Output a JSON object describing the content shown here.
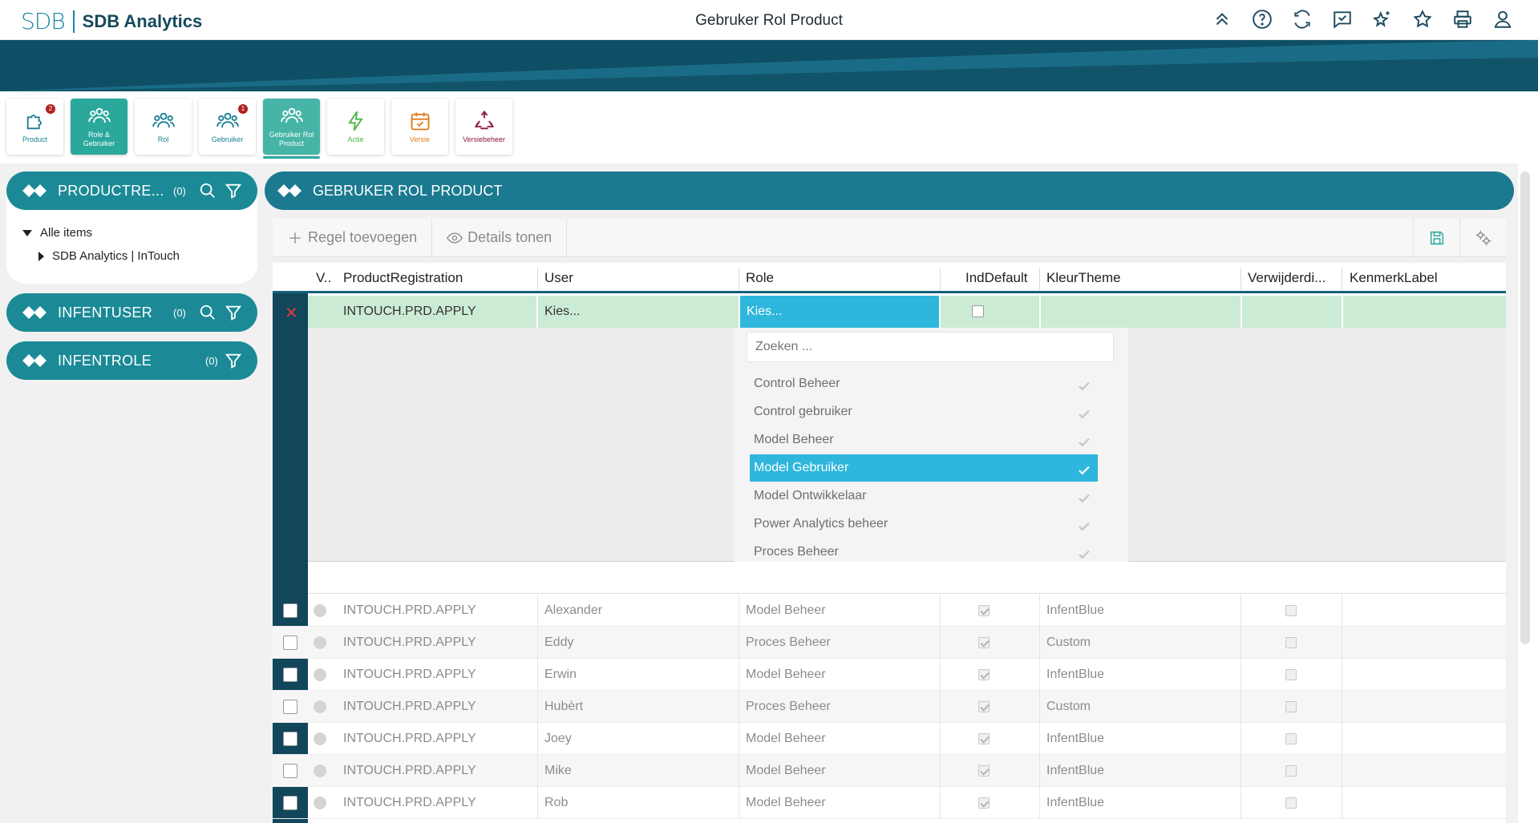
{
  "header": {
    "logo_mark": "SDB",
    "logo_text": "SDB Analytics",
    "title": "Gebruker Rol Product",
    "icons": [
      "chevrons-up-icon",
      "help-icon",
      "refresh-icon",
      "chat-check-icon",
      "sparkle-star-icon",
      "star-icon",
      "print-icon",
      "user-icon"
    ]
  },
  "tiles": [
    {
      "label": "Product",
      "badge": "2",
      "icon": "puzzle-icon"
    },
    {
      "label": "Role & Gebruiker",
      "badge": "",
      "icon": "users-icon"
    },
    {
      "label": "Rol",
      "badge": "",
      "icon": "users-icon"
    },
    {
      "label": "Gebruiker",
      "badge": "1",
      "icon": "users-icon"
    },
    {
      "label": "Gebruiker Rol Product",
      "badge": "",
      "icon": "users-icon"
    },
    {
      "label": "Actie",
      "badge": "",
      "icon": "lightning-icon"
    },
    {
      "label": "Versie",
      "badge": "",
      "icon": "calendar-check-icon"
    },
    {
      "label": "Versiebeheer",
      "badge": "",
      "icon": "recycle-icon"
    }
  ],
  "left": {
    "panels": [
      {
        "title": "PRODUCTRE...",
        "count": "(0)"
      },
      {
        "title": "INFENTUSER",
        "count": "(0)"
      },
      {
        "title": "INFENTROLE",
        "count": "(0)"
      }
    ],
    "tree": {
      "root": "Alle items",
      "child": "SDB Analytics | InTouch"
    }
  },
  "main": {
    "title": "GEBRUKER ROL PRODUCT",
    "add_row": "Regel toevoegen",
    "show_details": "Details tonen",
    "columns": [
      "V..",
      "ProductRegistration",
      "User",
      "Role",
      "IndDefault",
      "KleurTheme",
      "Verwijderdi...",
      "KenmerkLabel"
    ],
    "edit_row": {
      "product": "INTOUCH.PRD.APPLY",
      "user": "Kies...",
      "role": "Kies..."
    },
    "dropdown": {
      "placeholder": "Zoeken ...",
      "items": [
        "Control Beheer",
        "Control gebruiker",
        "Model Beheer",
        "Model Gebruiker",
        "Model Ontwikkelaar",
        "Power Analytics beheer",
        "Proces Beheer"
      ],
      "selected": "Model Gebruiker"
    },
    "rows": [
      {
        "product": "INTOUCH.PRD.APPLY",
        "user": "Alexander",
        "role": "Model Beheer",
        "theme": "InfentBlue"
      },
      {
        "product": "INTOUCH.PRD.APPLY",
        "user": "Eddy",
        "role": "Proces Beheer",
        "theme": "Custom"
      },
      {
        "product": "INTOUCH.PRD.APPLY",
        "user": "Erwin",
        "role": "Model Beheer",
        "theme": "InfentBlue"
      },
      {
        "product": "INTOUCH.PRD.APPLY",
        "user": "Hubèrt",
        "role": "Proces Beheer",
        "theme": "Custom"
      },
      {
        "product": "INTOUCH.PRD.APPLY",
        "user": "Joey",
        "role": "Model Beheer",
        "theme": "InfentBlue"
      },
      {
        "product": "INTOUCH.PRD.APPLY",
        "user": "Mike",
        "role": "Model Beheer",
        "theme": "InfentBlue"
      },
      {
        "product": "INTOUCH.PRD.APPLY",
        "user": "Rob",
        "role": "Model Beheer",
        "theme": "InfentBlue"
      }
    ]
  },
  "colors": {
    "teal": "#1b8a96",
    "navy": "#0f4f66",
    "selected": "#2eb6dc",
    "edit_row": "#ccebd4"
  }
}
